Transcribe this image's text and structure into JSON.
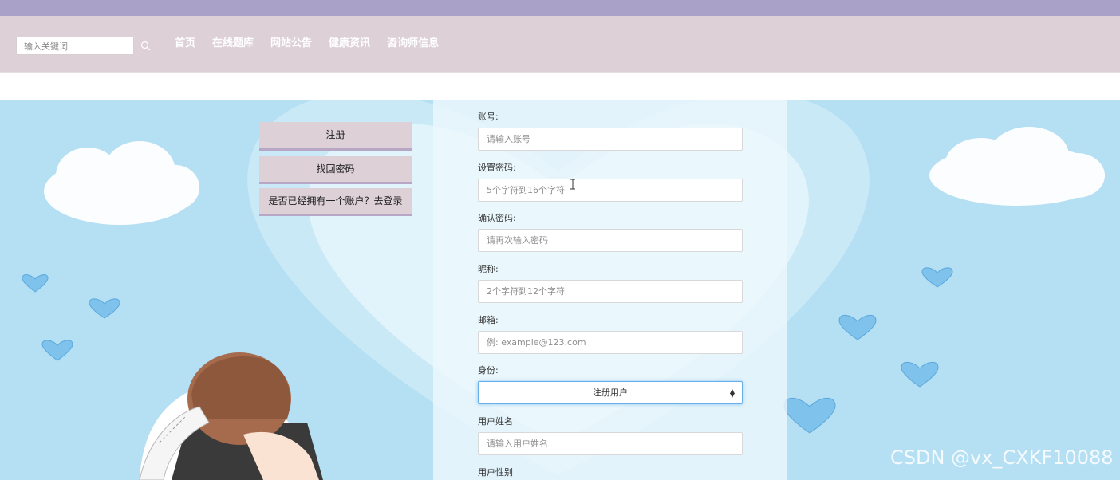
{
  "header": {
    "search_placeholder": "输入关键词",
    "nav": [
      "首页",
      "在线题库",
      "网站公告",
      "健康资讯",
      "咨询师信息"
    ]
  },
  "side_buttons": {
    "register": "注册",
    "forgot_password": "找回密码",
    "login_prompt": "是否已经拥有一个账户？去登录"
  },
  "form": {
    "account": {
      "label": "账号:",
      "placeholder": "请输入账号"
    },
    "password": {
      "label": "设置密码:",
      "placeholder": "5个字符到16个字符"
    },
    "confirm_password": {
      "label": "确认密码:",
      "placeholder": "请再次输入密码"
    },
    "nickname": {
      "label": "昵称:",
      "placeholder": "2个字符到12个字符"
    },
    "email": {
      "label": "邮箱:",
      "placeholder": "例: example@123.com"
    },
    "role": {
      "label": "身份:",
      "selected": "注册用户"
    },
    "real_name": {
      "label": "用户姓名",
      "placeholder": "请输入用户姓名"
    },
    "gender": {
      "label": "用户性别"
    }
  },
  "watermark": "CSDN @vx_CXKF10088",
  "colors": {
    "top_strip": "#a9a1c7",
    "navbar": "#ddd0d7",
    "sky": "#b5dff2",
    "button_bg": "#ddd0d7",
    "heart": "#7fc2ec"
  }
}
